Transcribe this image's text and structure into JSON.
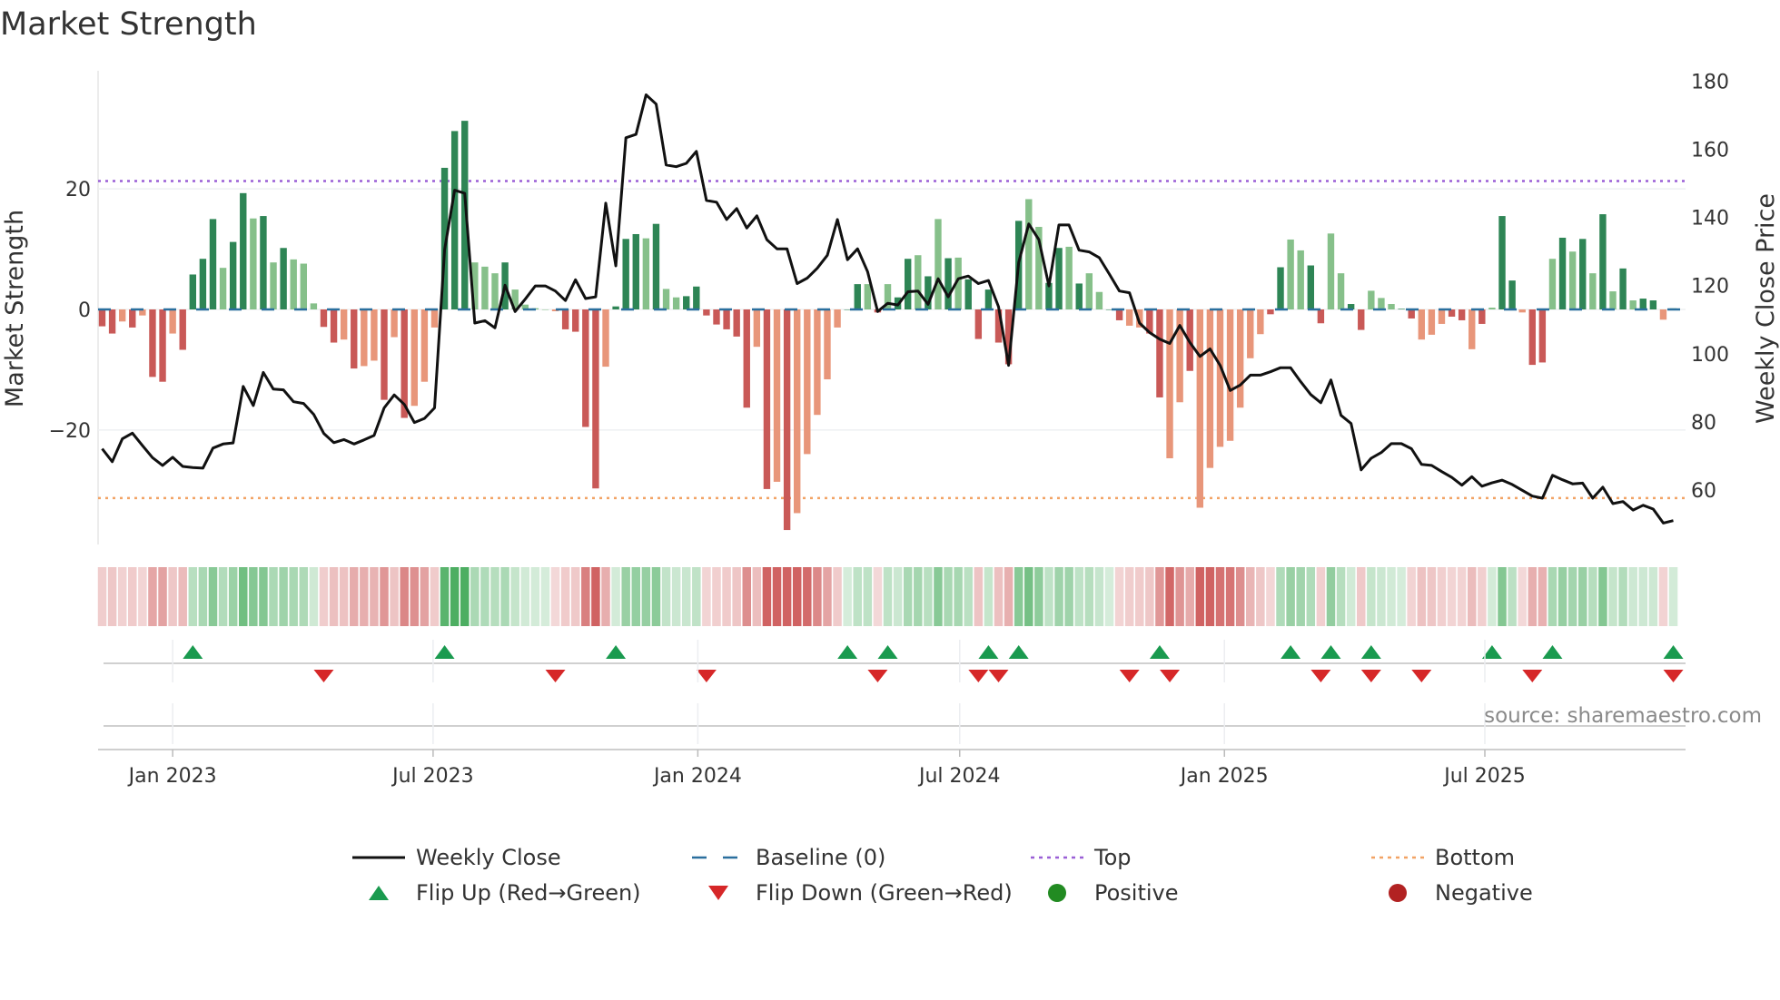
{
  "chart_data": {
    "type": "bar",
    "title": "Market Strength",
    "ylabel": "Market Strength",
    "y2label": "Weekly Close Price",
    "ylim": [
      -39,
      39
    ],
    "y2lim": [
      44,
      182
    ],
    "yticks": [
      -20,
      0,
      20
    ],
    "ytick_labels": [
      "−20",
      "0",
      "20"
    ],
    "y2ticks": [
      60,
      80,
      100,
      120,
      140,
      160,
      180
    ],
    "y2tick_labels": [
      "60",
      "80",
      "100",
      "120",
      "140",
      "160",
      "180"
    ],
    "x_start": "2022-11-13",
    "x_step_days": 7,
    "xticks": [
      {
        "date": "2023-01-01",
        "label": "Jan 2023"
      },
      {
        "date": "2023-07-01",
        "label": "Jul 2023"
      },
      {
        "date": "2024-01-01",
        "label": "Jan 2024"
      },
      {
        "date": "2024-07-01",
        "label": "Jul 2024"
      },
      {
        "date": "2025-01-01",
        "label": "Jan 2025"
      },
      {
        "date": "2025-07-01",
        "label": "Jul 2025"
      }
    ],
    "top_level": 21.3,
    "bottom_level": -31.3,
    "grid": true,
    "strength": [
      -2.8,
      -4,
      -2,
      -3,
      -1,
      -11.2,
      -12,
      -4,
      -6.7,
      5.8,
      8.4,
      15,
      6.9,
      11.2,
      19.3,
      15.1,
      15.5,
      7.8,
      10.2,
      8.3,
      7.6,
      1,
      -2.9,
      -5.5,
      -5,
      -9.8,
      -9.4,
      -8.5,
      -15,
      -4.6,
      -18,
      -16,
      -12,
      -3,
      23.5,
      29.6,
      31.3,
      7.8,
      7.1,
      6,
      7.8,
      3.3,
      0.8,
      0.2,
      0,
      -0.3,
      -3.3,
      -3.7,
      -19.5,
      -29.7,
      -9.5,
      0.5,
      11.7,
      12.5,
      11.8,
      14.2,
      3.4,
      2,
      2.2,
      3.8,
      -1,
      -2.5,
      -3.3,
      -4.5,
      -16.3,
      -6.2,
      -29.8,
      -28.6,
      -36.6,
      -33.8,
      -24,
      -17.5,
      -11.6,
      -3,
      0,
      4.2,
      4.2,
      -0.5,
      4.2,
      2,
      8.4,
      9,
      5.5,
      15,
      8.5,
      8.6,
      5,
      -4.9,
      3.3,
      -5.5,
      -9.1,
      14.7,
      18.3,
      13.7,
      4.4,
      10.2,
      10.4,
      4.3,
      6,
      2.9,
      0,
      -1.8,
      -2.7,
      -3,
      -4,
      -14.6,
      -24.7,
      -15.4,
      -10.2,
      -32.9,
      -26.3,
      -22.8,
      -21.8,
      -16.3,
      -8.1,
      -4.1,
      -0.8,
      7,
      11.6,
      9.8,
      7.3,
      -2.3,
      12.6,
      6,
      0.9,
      -3.4,
      3.1,
      1.9,
      0.9,
      0.1,
      -1.5,
      -5,
      -4.2,
      -2.4,
      -1.2,
      -1.8,
      -6.6,
      -2.4,
      0.3,
      15.5,
      4.8,
      -0.5,
      -9.2,
      -8.8,
      8.4,
      11.9,
      9.6,
      11.7,
      6,
      15.8,
      3,
      6.8,
      1.5,
      1.8,
      1.5,
      -1.7,
      0.2
    ],
    "strength_shade": "DDLDLDDLDDDDLDDLDLDLLLDDLDLLDLDLLLDDDLLLDLLLLLDDDDLDDDLDLLDDDDDDDLDLDLLLLLDDLDLDDLDLDLDDDDDDLLDDLDLLDDLLDDLLDLLLLLLLDDLLDDLLDDLLLDDLLLDDLDLDDLDDLDLDLDLDLDD",
    "weekly_close": [
      72.1,
      68.3,
      75,
      76.7,
      73,
      69.5,
      67.2,
      69.6,
      66.9,
      66.6,
      66.4,
      72.3,
      73.5,
      73.8,
      90.4,
      84.8,
      94.5,
      89.6,
      89.4,
      85.9,
      85.4,
      82.2,
      76.6,
      73.9,
      74.8,
      73.5,
      74.7,
      76,
      84.1,
      87.9,
      85.1,
      79.8,
      81,
      84.1,
      130.6,
      148,
      147.1,
      109,
      109.7,
      107.6,
      120.1,
      112.4,
      116,
      119.9,
      119.9,
      118.4,
      115.6,
      121.7,
      116.2,
      116.7,
      144.2,
      125.8,
      163.4,
      164.4,
      176,
      173.3,
      155.4,
      154.9,
      155.9,
      159.4,
      145,
      144.5,
      139.4,
      142.6,
      136.9,
      140.5,
      133.5,
      130.8,
      130.8,
      120.6,
      122.2,
      125.1,
      128.9,
      139.4,
      127.6,
      130.8,
      124.1,
      112.4,
      114.8,
      114.3,
      118.2,
      118.4,
      114.5,
      122,
      116.7,
      122,
      122.8,
      120.6,
      121.5,
      113.8,
      96.6,
      126.8,
      138.1,
      133.5,
      119.9,
      137.8,
      137.8,
      130.4,
      129.9,
      128.2,
      123.4,
      118.4,
      117.9,
      109,
      106.2,
      104.3,
      103,
      108.3,
      103.3,
      99.2,
      101.4,
      96.6,
      89.2,
      90.8,
      93.7,
      93.7,
      94.7,
      95.9,
      95.9,
      91.8,
      88,
      85.6,
      92.3,
      81.9,
      79.5,
      65.9,
      69.3,
      71,
      73.6,
      73.6,
      72.1,
      67.5,
      67.2,
      65.4,
      63.7,
      61.4,
      63.9,
      61.1,
      62.1,
      62.9,
      61.6,
      59.9,
      58.2,
      57.6,
      64.3,
      63,
      61.8,
      62,
      57.6,
      60.8,
      56,
      56.6,
      54.1,
      55.5,
      54.4,
      50.3,
      51
    ],
    "flip_up_weeks": [
      9,
      34,
      51,
      74,
      78,
      88,
      91,
      105,
      118,
      122,
      126,
      138,
      144,
      156
    ],
    "flip_down_weeks": [
      22,
      45,
      60,
      77,
      87,
      89,
      102,
      106,
      121,
      126,
      131,
      142,
      156
    ],
    "legend": {
      "placement": "bottom",
      "entries": [
        {
          "label": "Weekly Close",
          "symbol": "line"
        },
        {
          "label": "Baseline (0)",
          "symbol": "dash"
        },
        {
          "label": "Top",
          "symbol": "dot-purple"
        },
        {
          "label": "Bottom",
          "symbol": "dot-orange"
        },
        {
          "label": "Flip Up (Red→Green)",
          "symbol": "triangle-up"
        },
        {
          "label": "Flip Down (Green→Red)",
          "symbol": "triangle-down"
        },
        {
          "label": "Positive",
          "symbol": "circle-green"
        },
        {
          "label": "Negative",
          "symbol": "circle-red"
        }
      ]
    },
    "source": "source: sharemaestro.com",
    "colors": {
      "pos_dark": "#2e8555",
      "pos_light": "#86c08a",
      "neg_dark": "#c95957",
      "neg_light": "#e8967a",
      "line": "#111111",
      "baseline": "#2a6f9e",
      "top": "#9a5fd6",
      "bottom": "#f2a365",
      "flip_up": "#1a9a4f",
      "flip_down": "#d62728",
      "positive": "#228b22",
      "negative": "#b22222"
    }
  }
}
